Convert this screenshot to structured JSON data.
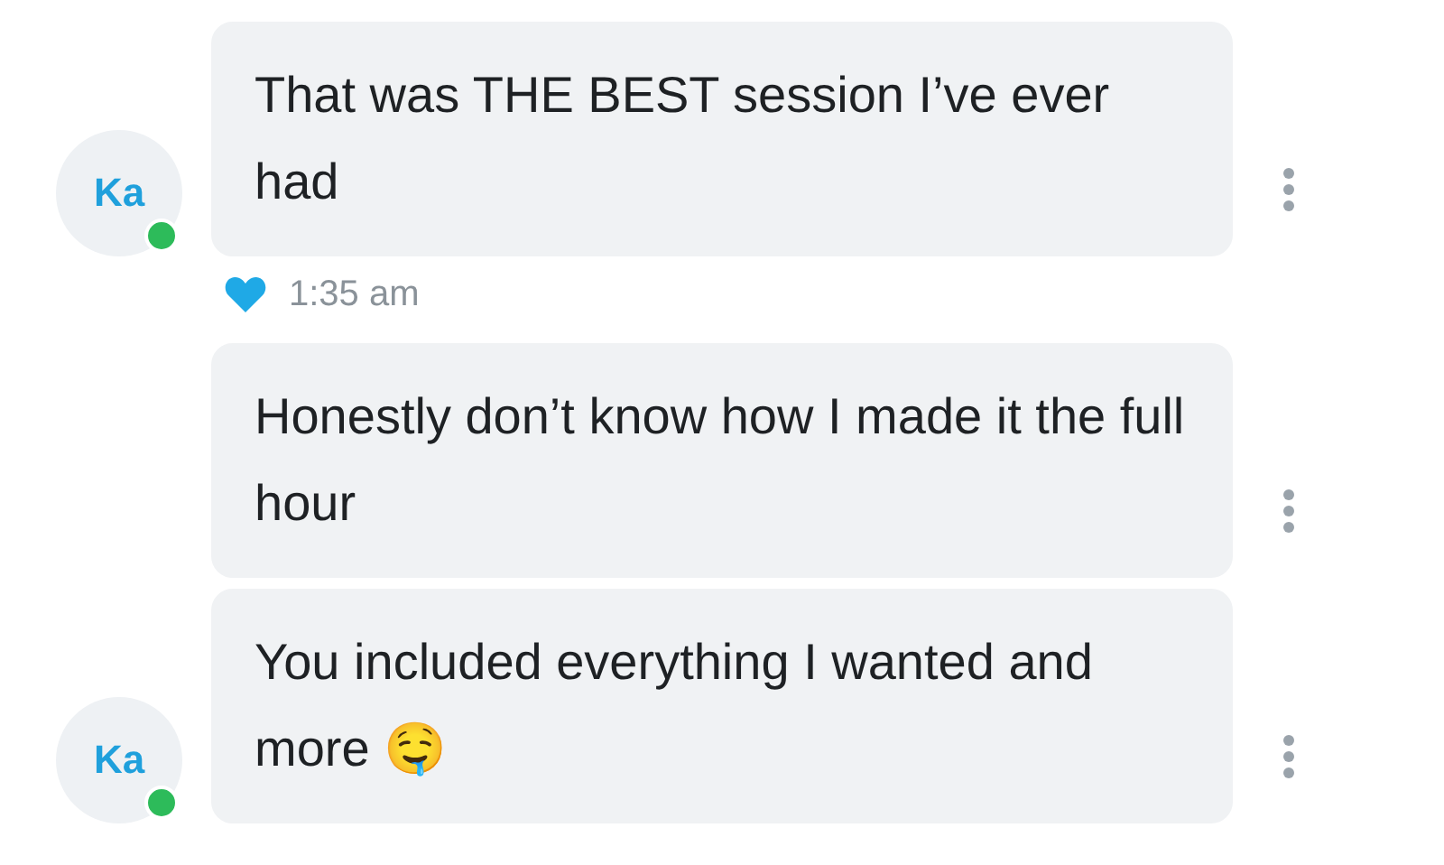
{
  "messages": [
    {
      "text": "That was THE BEST session I’ve ever had",
      "avatar": {
        "initials": "Ka",
        "online": true
      },
      "liked": true,
      "time": "1:35 am"
    },
    {
      "text": "Honestly don’t know how I made it the full hour"
    },
    {
      "text": "You included everything I wanted and more 🤤",
      "avatar": {
        "initials": "Ka",
        "online": true
      }
    }
  ]
}
